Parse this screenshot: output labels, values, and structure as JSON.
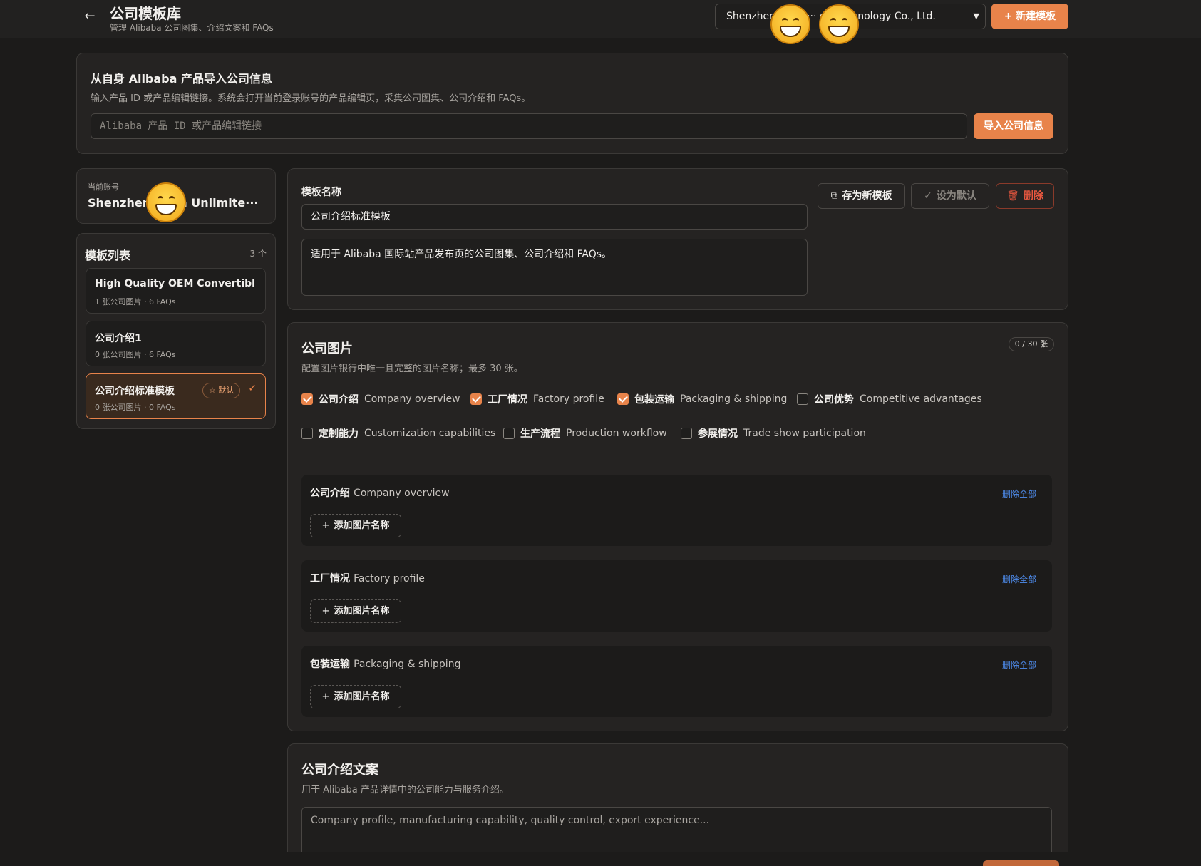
{
  "header": {
    "back_icon": "arrow-left-icon",
    "title": "公司模板库",
    "subtitle": "管理 Alibaba 公司图集、介绍文案和 FAQs",
    "account_select_value": "Shenzhen ··· an ··· ed Technology Co., Ltd.",
    "new_template_label": "新建模板"
  },
  "import_panel": {
    "title": "从自身 Alibaba 产品导入公司信息",
    "description": "输入产品 ID 或产品编辑链接。系统会打开当前登录账号的产品编辑页，采集公司图集、公司介绍和 FAQs。",
    "input_placeholder": "Alibaba 产品 ID 或产品编辑链接",
    "import_button": "导入公司信息"
  },
  "account_card": {
    "label": "当前账号",
    "name": "Shenzhen ··· an Unlimite···"
  },
  "template_list": {
    "title": "模板列表",
    "count": "3 个",
    "items": [
      {
        "name": "High Quality OEM Convertible ···",
        "meta": "1 张公司图片 · 6 FAQs",
        "active": false
      },
      {
        "name": "公司介绍1",
        "meta": "0 张公司图片 · 6 FAQs",
        "active": false
      },
      {
        "name": "公司介绍标准模板",
        "meta": "0 张公司图片 · 0 FAQs",
        "active": true,
        "badge": "默认"
      }
    ]
  },
  "editor": {
    "name_label": "模板名称",
    "name_value": "公司介绍标准模板",
    "description_value": "适用于 Alibaba 国际站产品发布页的公司图集、公司介绍和 FAQs。",
    "save_as_new": "存为新模板",
    "set_default": "设为默认",
    "delete": "删除"
  },
  "company_images": {
    "title": "公司图片",
    "description": "配置图片银行中唯一且完整的图片名称；最多 30 张。",
    "counter": "0 / 30 张",
    "categories": [
      {
        "zh": "公司介绍",
        "en": "Company overview",
        "checked": true
      },
      {
        "zh": "工厂情况",
        "en": "Factory profile",
        "checked": true
      },
      {
        "zh": "包装运输",
        "en": "Packaging & shipping",
        "checked": true
      },
      {
        "zh": "公司优势",
        "en": "Competitive advantages",
        "checked": false
      },
      {
        "zh": "定制能力",
        "en": "Customization capabilities",
        "checked": false
      },
      {
        "zh": "生产流程",
        "en": "Production workflow",
        "checked": false
      },
      {
        "zh": "参展情况",
        "en": "Trade show participation",
        "checked": false
      }
    ],
    "groups": [
      {
        "zh": "公司介绍",
        "en": "Company overview",
        "remove_all": "删除全部",
        "add_label": "添加图片名称"
      },
      {
        "zh": "工厂情况",
        "en": "Factory profile",
        "remove_all": "删除全部",
        "add_label": "添加图片名称"
      },
      {
        "zh": "包装运输",
        "en": "Packaging & shipping",
        "remove_all": "删除全部",
        "add_label": "添加图片名称"
      }
    ]
  },
  "company_intro": {
    "title": "公司介绍文案",
    "description": "用于 Alibaba 产品详情中的公司能力与服务介绍。",
    "placeholder": "Company profile, manufacturing capability, quality control, export experience..."
  },
  "colors": {
    "accent": "#e8834a",
    "background": "#1c1b1a",
    "card": "#252322",
    "danger": "#e8573f",
    "link": "#4f8ef0"
  }
}
